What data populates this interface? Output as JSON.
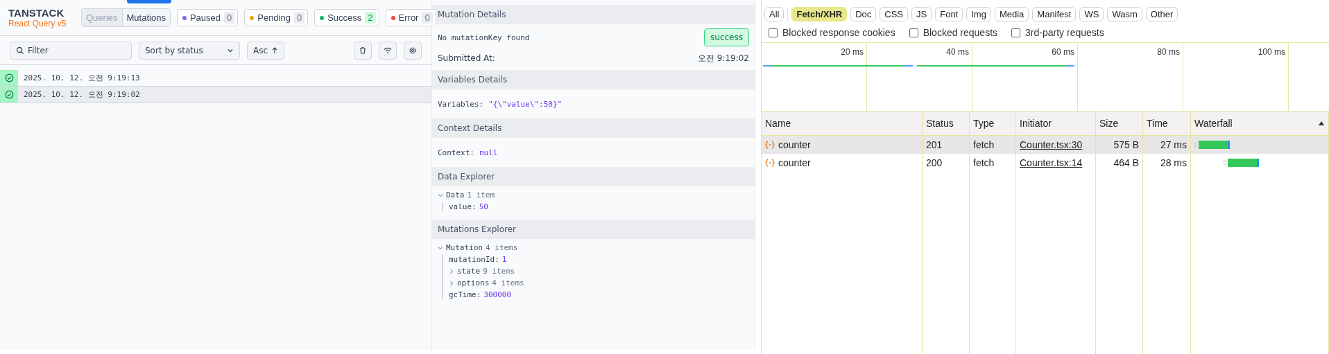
{
  "devtools": {
    "logo": {
      "title": "TANSTACK",
      "subtitle": "React Query v5"
    },
    "view_toggle": [
      {
        "label": "Queries",
        "selected": false
      },
      {
        "label": "Mutations",
        "selected": true
      }
    ],
    "status_badges": [
      {
        "label": "Paused",
        "count": "0",
        "color": "#8b5cf6",
        "highlighted": false
      },
      {
        "label": "Pending",
        "count": "0",
        "color": "#f59e0b",
        "highlighted": false
      },
      {
        "label": "Success",
        "count": "2",
        "color": "#12b76a",
        "highlighted": true
      },
      {
        "label": "Error",
        "count": "0",
        "color": "#f04438",
        "highlighted": false
      }
    ],
    "filter": {
      "placeholder": "Filter"
    },
    "sort": {
      "value": "Sort by status"
    },
    "order": {
      "label": "Asc"
    },
    "mutations": [
      {
        "time": "2025. 10. 12. 오전 9:19:13",
        "selected": false
      },
      {
        "time": "2025. 10. 12. 오전 9:19:02",
        "selected": true
      }
    ],
    "details": {
      "sections": [
        {
          "title": "Mutation Details",
          "kind": "summary",
          "key_text": "No mutationKey found",
          "status": "success",
          "submitted_label": "Submitted At:",
          "submitted_value": "오전 9:19:02"
        },
        {
          "title": "Variables Details",
          "kind": "value",
          "label": "Variables:",
          "value": "\"{\\\"value\\\":50}\""
        },
        {
          "title": "Context Details",
          "kind": "value",
          "label": "Context:",
          "value": "null"
        },
        {
          "title": "Data Explorer",
          "kind": "tree",
          "root": {
            "label": "Data",
            "count": "1 item",
            "expanded": true,
            "children": [
              {
                "label": "value:",
                "value": "50"
              }
            ]
          }
        },
        {
          "title": "Mutations Explorer",
          "kind": "tree",
          "root": {
            "label": "Mutation",
            "count": "4 items",
            "expanded": true,
            "children": [
              {
                "label": "mutationId:",
                "value": "1"
              },
              {
                "label": "state",
                "count": "9 items",
                "expanded": false
              },
              {
                "label": "options",
                "count": "4 items",
                "expanded": false
              },
              {
                "label": "gcTime:",
                "value": "300000"
              }
            ]
          }
        }
      ]
    }
  },
  "network": {
    "type_filters": [
      {
        "label": "All",
        "selected": false
      },
      {
        "label": "Fetch/XHR",
        "selected": true
      },
      {
        "label": "Doc",
        "selected": false
      },
      {
        "label": "CSS",
        "selected": false
      },
      {
        "label": "JS",
        "selected": false
      },
      {
        "label": "Font",
        "selected": false
      },
      {
        "label": "Img",
        "selected": false
      },
      {
        "label": "Media",
        "selected": false
      },
      {
        "label": "Manifest",
        "selected": false
      },
      {
        "label": "WS",
        "selected": false
      },
      {
        "label": "Wasm",
        "selected": false
      },
      {
        "label": "Other",
        "selected": false
      }
    ],
    "options": [
      {
        "label": "Blocked response cookies",
        "checked": false
      },
      {
        "label": "Blocked requests",
        "checked": false
      },
      {
        "label": "3rd-party requests",
        "checked": false
      }
    ],
    "timeline_ticks": [
      "20 ms",
      "40 ms",
      "60 ms",
      "80 ms",
      "100 ms"
    ],
    "columns": [
      "Name",
      "Status",
      "Type",
      "Initiator",
      "Size",
      "Time",
      "Waterfall"
    ],
    "rows": [
      {
        "name": "counter",
        "status": "201",
        "type": "fetch",
        "initiator": "Counter.tsx:30",
        "size": "575 B",
        "time": "27 ms",
        "selected": true
      },
      {
        "name": "counter",
        "status": "200",
        "type": "fetch",
        "initiator": "Counter.tsx:14",
        "size": "464 B",
        "time": "28 ms",
        "selected": false
      }
    ]
  }
}
